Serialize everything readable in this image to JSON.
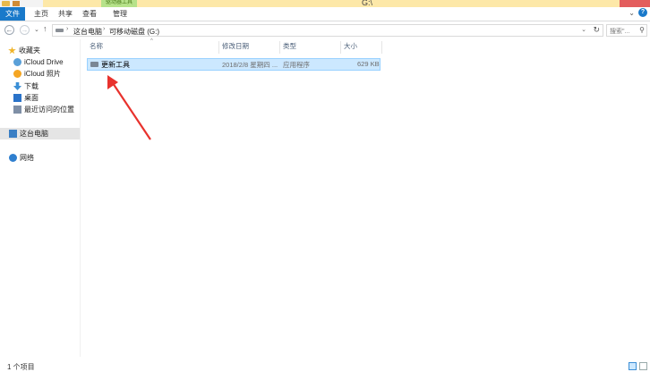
{
  "window": {
    "title": "G:\\",
    "context_tab_label": "驱动器工具"
  },
  "ribbon": {
    "tabs": [
      "文件",
      "主页",
      "共享",
      "查看",
      "管理"
    ],
    "expand_glyph": "⌄",
    "help_glyph": "?"
  },
  "address": {
    "back_glyph": "←",
    "forward_glyph": "→",
    "recent_glyph": "⌄",
    "up_glyph": "↑",
    "crumbs": [
      "这台电脑",
      "可移动磁盘 (G:)"
    ],
    "separator": "›",
    "dropdown_glyph": "⌄",
    "refresh_glyph": "↻",
    "search_placeholder": "搜索\"...",
    "search_glyph": "⚲"
  },
  "navpane": {
    "items": [
      {
        "label": "收藏夹",
        "icon": "star-icon"
      },
      {
        "label": "iCloud Drive",
        "icon": "cloud-icon"
      },
      {
        "label": "iCloud 照片",
        "icon": "photos-icon"
      },
      {
        "label": "下载",
        "icon": "download-icon"
      },
      {
        "label": "桌面",
        "icon": "desktop-icon"
      },
      {
        "label": "最近访问的位置",
        "icon": "recent-icon"
      },
      {
        "label": "这台电脑",
        "icon": "computer-icon"
      },
      {
        "label": "网络",
        "icon": "network-icon"
      }
    ]
  },
  "columns": [
    "名称",
    "修改日期",
    "类型",
    "大小"
  ],
  "files": [
    {
      "name": "更新工具",
      "modified": "2018/2/8 星期四 ...",
      "type": "应用程序",
      "size": "629 KB"
    }
  ],
  "status": {
    "count": "1 个项目"
  },
  "colors": {
    "accent": "#1979ca",
    "selection": "#cce8ff",
    "arrow": "#e8322d"
  }
}
